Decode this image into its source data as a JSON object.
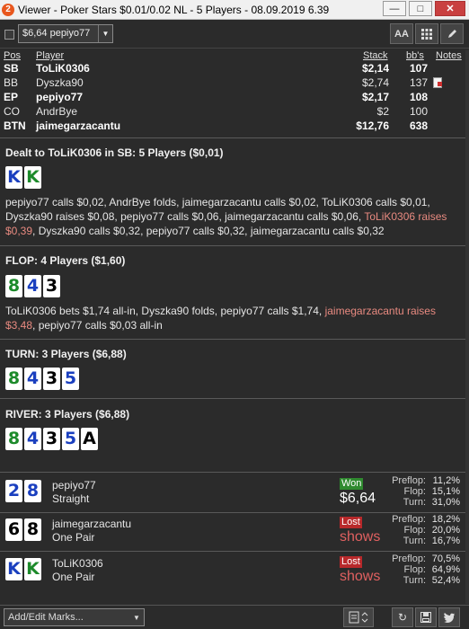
{
  "window": {
    "title": "Viewer - Poker Stars $0.01/0.02 NL - 5 Players - 08.09.2019 6.39",
    "icon_text": "2"
  },
  "toolbar": {
    "combo_value": "$6,64 pepiyo77",
    "font_btn": "AA"
  },
  "players": {
    "headers": {
      "pos": "Pos",
      "player": "Player",
      "stack": "Stack",
      "bbs": "bb's",
      "notes": "Notes"
    },
    "rows": [
      {
        "pos": "SB",
        "name": "ToLiK0306",
        "stack": "$2,14",
        "bbs": "107",
        "bold": true
      },
      {
        "pos": "BB",
        "name": "Dyszka90",
        "stack": "$2,74",
        "bbs": "137",
        "bold": false
      },
      {
        "pos": "EP",
        "name": "pepiyo77",
        "stack": "$2,17",
        "bbs": "108",
        "bold": true
      },
      {
        "pos": "CO",
        "name": "AndrBye",
        "stack": "$2",
        "bbs": "100",
        "bold": false
      },
      {
        "pos": "BTN",
        "name": "jaimegarzacantu",
        "stack": "$12,76",
        "bbs": "638",
        "bold": true
      }
    ]
  },
  "preflop": {
    "header": "Dealt to ToLiK0306 in SB: 5 Players ($0,01)",
    "cards": [
      {
        "rank": "K",
        "suit": "d"
      },
      {
        "rank": "K",
        "suit": "c"
      }
    ],
    "action": "pepiyo77 calls $0,02, AndrBye folds, jaimegarzacantu calls $0,02, ToLiK0306 calls $0,01, Dyszka90 raises $0,08, pepiyo77 calls $0,06, jaimegarzacantu calls $0,06, ",
    "action_hl": "ToLiK0306 raises $0,39",
    "action_tail": ", Dyszka90 calls $0,32, pepiyo77 calls $0,32, jaimegarzacantu calls $0,32"
  },
  "flop": {
    "header": "FLOP: 4 Players ($1,60)",
    "cards": [
      {
        "rank": "8",
        "suit": "c"
      },
      {
        "rank": "4",
        "suit": "d"
      },
      {
        "rank": "3",
        "suit": "s"
      }
    ],
    "action": "ToLiK0306 bets $1,74 all-in, Dyszka90 folds, pepiyo77 calls $1,74, ",
    "action_hl": "jaimegarzacantu raises $3,48",
    "action_tail": ", pepiyo77 calls $0,03 all-in"
  },
  "turn": {
    "header": "TURN: 3 Players ($6,88)",
    "cards": [
      {
        "rank": "8",
        "suit": "c"
      },
      {
        "rank": "4",
        "suit": "d"
      },
      {
        "rank": "3",
        "suit": "s"
      },
      {
        "rank": "5",
        "suit": "d"
      }
    ]
  },
  "river": {
    "header": "RIVER: 3 Players ($6,88)",
    "cards": [
      {
        "rank": "8",
        "suit": "c"
      },
      {
        "rank": "4",
        "suit": "d"
      },
      {
        "rank": "3",
        "suit": "s"
      },
      {
        "rank": "5",
        "suit": "d"
      },
      {
        "rank": "A",
        "suit": "s"
      }
    ]
  },
  "results": [
    {
      "cards": [
        {
          "rank": "2",
          "suit": "d"
        },
        {
          "rank": "8",
          "suit": "d"
        }
      ],
      "name": "pepiyo77",
      "hand": "Straight",
      "badge": "Won",
      "outcome": "$6,64",
      "stats": [
        {
          "k": "Preflop:",
          "v": "11,2%"
        },
        {
          "k": "Flop:",
          "v": "15,1%"
        },
        {
          "k": "Turn:",
          "v": "31,0%"
        }
      ]
    },
    {
      "cards": [
        {
          "rank": "6",
          "suit": "s"
        },
        {
          "rank": "8",
          "suit": "s"
        }
      ],
      "name": "jaimegarzacantu",
      "hand": "One Pair",
      "badge": "Lost",
      "outcome": "shows",
      "stats": [
        {
          "k": "Preflop:",
          "v": "18,2%"
        },
        {
          "k": "Flop:",
          "v": "20,0%"
        },
        {
          "k": "Turn:",
          "v": "16,7%"
        }
      ]
    },
    {
      "cards": [
        {
          "rank": "K",
          "suit": "d"
        },
        {
          "rank": "K",
          "suit": "c"
        }
      ],
      "name": "ToLiK0306",
      "hand": "One Pair",
      "badge": "Lost",
      "outcome": "shows",
      "stats": [
        {
          "k": "Preflop:",
          "v": "70,5%"
        },
        {
          "k": "Flop:",
          "v": "64,9%"
        },
        {
          "k": "Turn:",
          "v": "52,4%"
        }
      ]
    }
  ],
  "footer": {
    "marks_label": "Add/Edit Marks..."
  },
  "colors": {
    "club": "#1c8a2a",
    "diamond": "#1a3fbf",
    "spade": "#000000",
    "highlight": "#e88a80",
    "won": "#2f8a2f",
    "lost": "#b8292b"
  }
}
